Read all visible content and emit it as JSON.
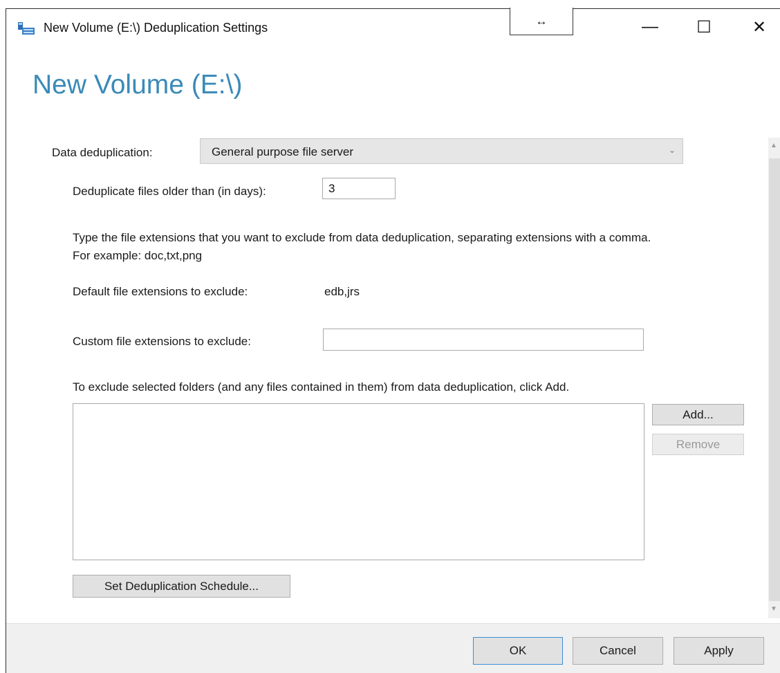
{
  "window": {
    "title": "New Volume (E:\\) Deduplication Settings",
    "resize_glyph": "↔",
    "minimize_glyph": "—",
    "maximize_glyph": "☐",
    "close_glyph": "✕",
    "app_icon": "volume-settings-icon"
  },
  "page": {
    "heading": "New Volume (E:\\)"
  },
  "dedup": {
    "label": "Data deduplication:",
    "selected": "General purpose file server",
    "arrow": "⌄"
  },
  "age": {
    "label": "Deduplicate files older than (in days):",
    "value": "3"
  },
  "extensions": {
    "description": "Type the file extensions that you want to exclude from data deduplication, separating extensions with a comma. For example: doc,txt,png",
    "default_label": "Default file extensions to exclude:",
    "default_value": "edb,jrs",
    "custom_label": "Custom file extensions to exclude:",
    "custom_value": ""
  },
  "folders": {
    "description": "To exclude selected folders (and any files contained in them) from data deduplication, click Add.",
    "items": [],
    "add_label": "Add...",
    "remove_label": "Remove"
  },
  "schedule": {
    "button_label": "Set Deduplication Schedule..."
  },
  "footer": {
    "ok_label": "OK",
    "cancel_label": "Cancel",
    "apply_label": "Apply"
  },
  "colors": {
    "heading": "#3a8ab8",
    "ok_border": "#3c8fd4"
  }
}
